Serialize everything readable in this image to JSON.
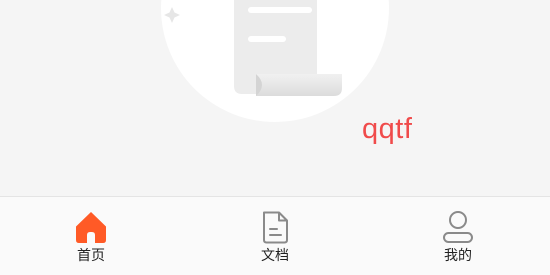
{
  "empty_state": {
    "message": "qqtf"
  },
  "tabbar": {
    "items": [
      {
        "label": "首页",
        "icon": "home-icon",
        "active": true
      },
      {
        "label": "文档",
        "icon": "document-icon",
        "active": false
      },
      {
        "label": "我的",
        "icon": "user-icon",
        "active": false
      }
    ]
  },
  "colors": {
    "accent": "#ff5a26",
    "message": "#f04b4b",
    "icon_inactive": "#8a8a8a",
    "tabbar_bg": "#fafafa",
    "page_bg": "#f5f5f5"
  }
}
